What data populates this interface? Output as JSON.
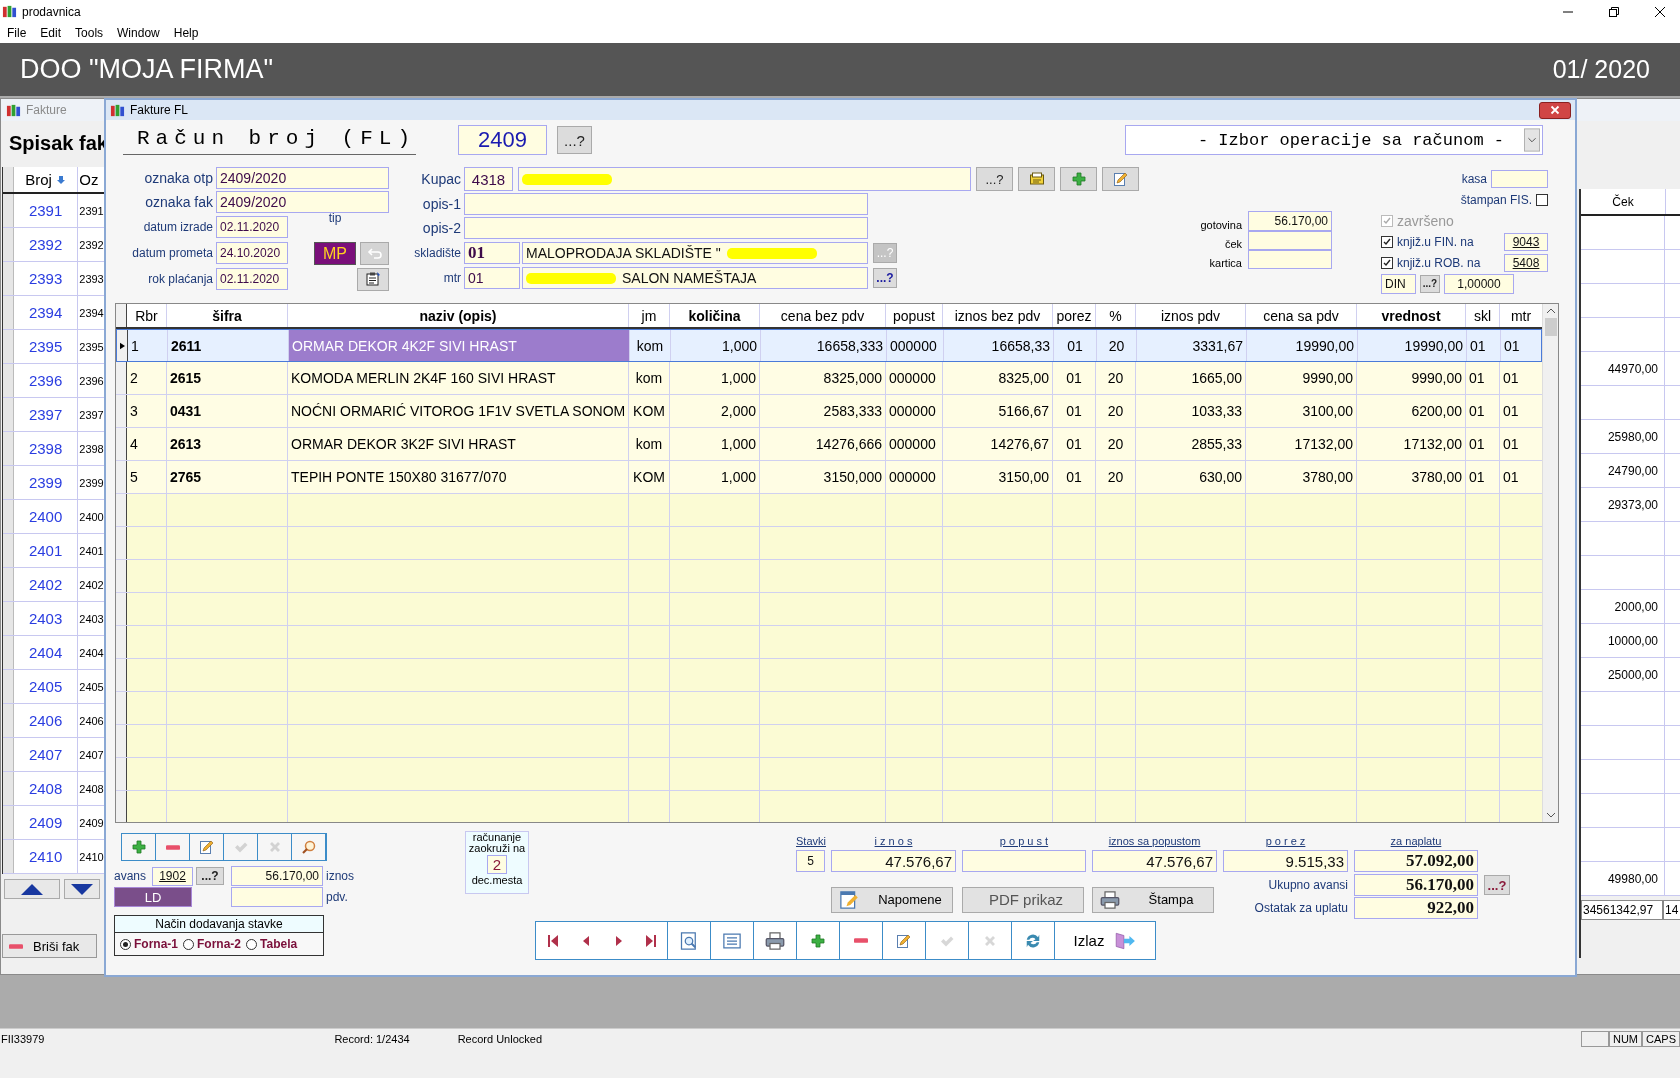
{
  "app": {
    "title": "prodavnica"
  },
  "menu": [
    "File",
    "Edit",
    "Tools",
    "Window",
    "Help"
  ],
  "banner": {
    "company": "DOO  \"MOJA FIRMA\"",
    "period": "01/ 2020"
  },
  "list_window": {
    "title": "Fakture",
    "heading": "Spisak fak",
    "columns": [
      "Broj",
      "Oz"
    ],
    "cek_header": "Ček",
    "rows": [
      {
        "broj": "2391",
        "ozn": "2391"
      },
      {
        "broj": "2392",
        "ozn": "2392"
      },
      {
        "broj": "2393",
        "ozn": "2393"
      },
      {
        "broj": "2394",
        "ozn": "2394"
      },
      {
        "broj": "2395",
        "ozn": "2395",
        "cek": "44970,00"
      },
      {
        "broj": "2396",
        "ozn": "2396"
      },
      {
        "broj": "2397",
        "ozn": "2397",
        "cek": "25980,00"
      },
      {
        "broj": "2398",
        "ozn": "2398",
        "cek": "24790,00"
      },
      {
        "broj": "2399",
        "ozn": "2399",
        "cek": "29373,00"
      },
      {
        "broj": "2400",
        "ozn": "2400"
      },
      {
        "broj": "2401",
        "ozn": "2401"
      },
      {
        "broj": "2402",
        "ozn": "2402",
        "cek": "2000,00"
      },
      {
        "broj": "2403",
        "ozn": "2403",
        "cek": "10000,00"
      },
      {
        "broj": "2404",
        "ozn": "2404",
        "cek": "25000,00"
      },
      {
        "broj": "2405",
        "ozn": "2405"
      },
      {
        "broj": "2406",
        "ozn": "2406"
      },
      {
        "broj": "2407",
        "ozn": "2407"
      },
      {
        "broj": "2408",
        "ozn": "2408"
      },
      {
        "broj": "2409",
        "ozn": "2409"
      },
      {
        "broj": "2410",
        "ozn": "2410",
        "cek": "49980,00"
      }
    ],
    "totals": [
      "34561342,97",
      "14"
    ],
    "delete_button": "Briši fak"
  },
  "invoice_window": {
    "title": "Fakture FL",
    "heading": "Račun broj (FL)",
    "number": "2409",
    "lookup": "...?",
    "operation": "- Izbor operacije sa računom -",
    "fields": [
      {
        "label": "oznaka otp",
        "value": "2409/2020",
        "kind": "wide"
      },
      {
        "label": "oznaka fak",
        "value": "2409/2020",
        "kind": "wide"
      },
      {
        "label": "datum izrade",
        "value": "02.11.2020",
        "kind": "date"
      },
      {
        "label": "datum prometa",
        "value": "24.10.2020",
        "kind": "date"
      },
      {
        "label": "rok plaćanja",
        "value": "02.11.2020",
        "kind": "date"
      }
    ],
    "tip": {
      "label": "tip",
      "value": "MP"
    },
    "customer": {
      "label": "Kupac",
      "code": "4318",
      "name_parts": [
        {
          "kind": "redaction"
        }
      ],
      "buttons": [
        {
          "kind": "lookup",
          "label": "...?"
        },
        {
          "kind": "card"
        },
        {
          "kind": "add"
        },
        {
          "kind": "edit"
        }
      ]
    },
    "descriptions": [
      {
        "label": "opis-1"
      },
      {
        "label": "opis-2"
      }
    ],
    "warehouse": {
      "label": "skladište",
      "code": "01",
      "name_parts": [
        {
          "kind": "text",
          "text": "MALOPRODAJA SKLADIŠTE \""
        },
        {
          "kind": "redaction"
        }
      ],
      "lookup": "...?"
    },
    "cost_center": {
      "label": "mtr",
      "code": "01",
      "name_parts": [
        {
          "kind": "redaction"
        },
        {
          "kind": "text",
          "text": "SALON NAMEŠTAJA"
        }
      ],
      "lookup": "...?"
    },
    "payments": [
      {
        "label": "gotovina",
        "value": "56.170,00"
      },
      {
        "label": "ček"
      },
      {
        "label": "kartica"
      }
    ],
    "kasa": {
      "label": "kasa"
    },
    "fiscal": {
      "label": "štampan FIS.",
      "checked": false
    },
    "flags": [
      {
        "label": "završeno",
        "checked": true,
        "disabled": true
      },
      {
        "label": "knjiž.u FIN. na",
        "checked": true,
        "disabled": false,
        "value": "9043"
      },
      {
        "label": "knjiž.u ROB. na",
        "checked": true,
        "disabled": false,
        "value": "5408"
      }
    ],
    "currency": {
      "code": "DIN",
      "lookup": "...?",
      "rate": "1,00000"
    },
    "items": {
      "columns": [
        {
          "label": "Rbr",
          "bold": false
        },
        {
          "label": "šifra",
          "bold": true
        },
        {
          "label": "naziv (opis)",
          "bold": true
        },
        {
          "label": "jm",
          "bold": false
        },
        {
          "label": "količina",
          "bold": true
        },
        {
          "label": "cena bez pdv",
          "bold": false
        },
        {
          "label": "popust",
          "bold": false
        },
        {
          "label": "iznos bez pdv",
          "bold": false
        },
        {
          "label": "porez",
          "bold": false
        },
        {
          "label": "%",
          "bold": false
        },
        {
          "label": "iznos pdv",
          "bold": false
        },
        {
          "label": "cena sa pdv",
          "bold": false
        },
        {
          "label": "vrednost",
          "bold": true
        },
        {
          "label": "skl",
          "bold": false
        },
        {
          "label": "mtr",
          "bold": false
        }
      ],
      "rows": [
        {
          "selected": true,
          "cells": [
            "1",
            "2611",
            "ORMAR DEKOR 4K2F SIVI HRAST",
            "kom",
            "1,000",
            "16658,333",
            "000000",
            "16658,33",
            "01",
            "20",
            "3331,67",
            "19990,00",
            "19990,00",
            "01",
            "01"
          ]
        },
        {
          "selected": false,
          "cells": [
            "2",
            "2615",
            "KOMODA MERLIN 2K4F 160 SIVI HRAST",
            "kom",
            "1,000",
            "8325,000",
            "000000",
            "8325,00",
            "01",
            "20",
            "1665,00",
            "9990,00",
            "9990,00",
            "01",
            "01"
          ]
        },
        {
          "selected": false,
          "cells": [
            "3",
            "0431",
            "NOĆNI ORMARIĆ VITOROG 1F1V SVETLA SONOM",
            "KOM",
            "2,000",
            "2583,333",
            "000000",
            "5166,67",
            "01",
            "20",
            "1033,33",
            "3100,00",
            "6200,00",
            "01",
            "01"
          ]
        },
        {
          "selected": false,
          "cells": [
            "4",
            "2613",
            "ORMAR DEKOR 3K2F SIVI HRAST",
            "kom",
            "1,000",
            "14276,666",
            "000000",
            "14276,67",
            "01",
            "20",
            "2855,33",
            "17132,00",
            "17132,00",
            "01",
            "01"
          ]
        },
        {
          "selected": false,
          "cells": [
            "5",
            "2765",
            "TEPIH PONTE 150X80 31677/070",
            "KOM",
            "1,000",
            "3150,000",
            "000000",
            "3150,00",
            "01",
            "20",
            "630,00",
            "3780,00",
            "3780,00",
            "01",
            "01"
          ]
        }
      ]
    },
    "item_tools": [
      {
        "kind": "add",
        "disabled": false
      },
      {
        "kind": "remove",
        "disabled": false
      },
      {
        "kind": "edit",
        "disabled": false
      },
      {
        "kind": "confirm",
        "disabled": true
      },
      {
        "kind": "cancel",
        "disabled": true
      },
      {
        "kind": "search",
        "disabled": false
      }
    ],
    "advance": {
      "label": "avans",
      "number": "1902",
      "lookup": "...?",
      "amount": "56.170,00",
      "amount_label": "iznos",
      "vat_label": "pdv."
    },
    "ld_button": "LD",
    "add_mode": {
      "title": "Način dodavanja stavke",
      "options": [
        {
          "label": "Forna-1",
          "selected": true
        },
        {
          "label": "Forna-2",
          "selected": false
        },
        {
          "label": "Tabela",
          "selected": false
        }
      ]
    },
    "rounding": {
      "label_top": "računanje zaokruži na",
      "digits": "2",
      "label_bottom": "dec.mesta"
    },
    "totals": {
      "columns": [
        {
          "label": "Stavki",
          "value": "5"
        },
        {
          "label": "i z n o s",
          "value": "47.576,67"
        },
        {
          "label": "p o p u s t"
        },
        {
          "label": "iznos sa popustom",
          "value": "47.576,67"
        },
        {
          "label": "p o r e z",
          "value": "9.515,33"
        },
        {
          "label": "za naplatu",
          "value": "57.092,00"
        }
      ],
      "advances": {
        "label": "Ukupno avansi",
        "value": "56.170,00",
        "lookup": "...?"
      },
      "remaining": {
        "label": "Ostatak za uplatu",
        "value": "922,00"
      }
    },
    "actions": [
      {
        "kind": "notes",
        "label": "Napomene"
      },
      {
        "kind": "pdf",
        "label": "PDF prikaz"
      },
      {
        "kind": "print",
        "label": "Štampa"
      }
    ],
    "nav": [
      {
        "kind": "first",
        "disabled": false
      },
      {
        "kind": "prev",
        "disabled": false
      },
      {
        "kind": "next",
        "disabled": false
      },
      {
        "kind": "last",
        "disabled": false
      },
      {
        "kind": "preview",
        "disabled": false
      },
      {
        "kind": "list",
        "disabled": false
      },
      {
        "kind": "print",
        "disabled": false
      },
      {
        "kind": "add",
        "disabled": false
      },
      {
        "kind": "remove",
        "disabled": false
      },
      {
        "kind": "edit",
        "disabled": false
      },
      {
        "kind": "confirm",
        "disabled": true
      },
      {
        "kind": "cancel",
        "disabled": true
      },
      {
        "kind": "refresh",
        "disabled": false
      },
      {
        "kind": "exit",
        "label": "Izlaz",
        "disabled": false
      }
    ]
  },
  "status_bar": {
    "left": "FII33979",
    "record": "Record: 1/2434",
    "lock": "Record Unlocked",
    "indicators": [
      "NUM",
      "CAPS"
    ]
  }
}
